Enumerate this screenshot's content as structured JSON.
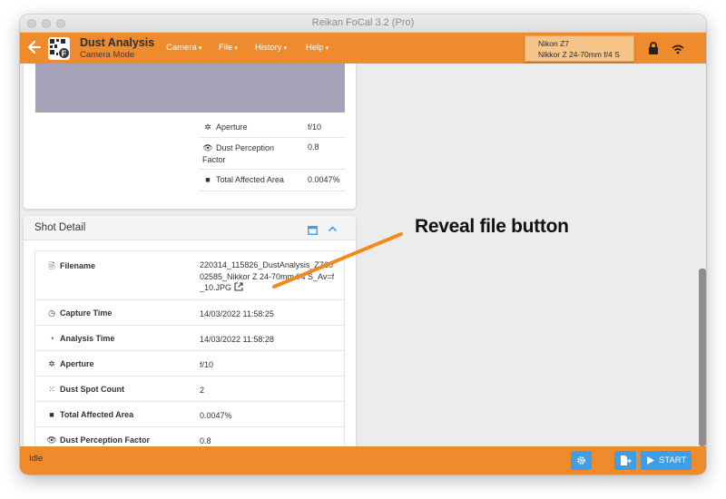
{
  "window": {
    "title": "Reikan FoCal 3.2 (Pro)"
  },
  "appbar": {
    "title": "Dust Analysis",
    "subtitle": "Camera Mode",
    "menus": [
      {
        "label": "Camera"
      },
      {
        "label": "File"
      },
      {
        "label": "History"
      },
      {
        "label": "Help"
      }
    ],
    "camera": {
      "body": "Nikon Z7",
      "lens": "Nikkor Z 24-70mm f/4 S"
    }
  },
  "summary": {
    "rows": [
      {
        "label": "Aperture",
        "value": "f/10",
        "icon": "aperture-icon"
      },
      {
        "label": "Dust Perception Factor",
        "value": "0.8",
        "icon": "eye-icon"
      },
      {
        "label": "Total Affected Area",
        "value": "0.0047%",
        "icon": "square-icon"
      }
    ]
  },
  "shot_detail": {
    "title": "Shot Detail",
    "rows": [
      {
        "label": "Filename",
        "value": "220314_115826_DustAnalysis_Z76002585_Nikkor Z 24-70mm f/4 S_Av=f_10.JPG",
        "icon": "file-icon"
      },
      {
        "label": "Capture Time",
        "value": "14/03/2022 11:58:25",
        "icon": "clock-icon"
      },
      {
        "label": "Analysis Time",
        "value": "14/03/2022 11:58:28",
        "icon": "clock-filled-icon"
      },
      {
        "label": "Aperture",
        "value": "f/10",
        "icon": "aperture-icon"
      },
      {
        "label": "Dust Spot Count",
        "value": "2",
        "icon": "dots-icon"
      },
      {
        "label": "Total Affected Area",
        "value": "0.0047%",
        "icon": "square-icon"
      },
      {
        "label": "Dust Perception Factor",
        "value": "0.8",
        "icon": "eye-icon"
      }
    ]
  },
  "footer": {
    "status": "Idle",
    "start_label": "START"
  },
  "annotation": {
    "text": "Reveal file button",
    "color": "#f28a1d"
  },
  "colors": {
    "accent": "#ef8b2c",
    "button": "#3e9ee6"
  }
}
